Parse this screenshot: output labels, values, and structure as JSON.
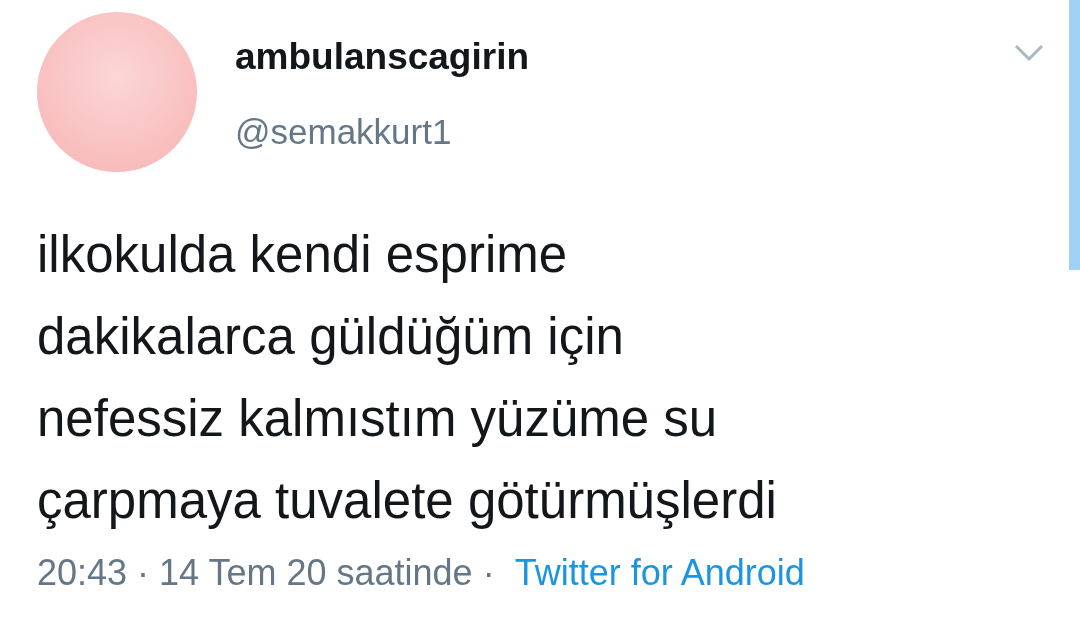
{
  "author": {
    "name": "ambulanscagirin",
    "handle": "@semakkurt1"
  },
  "tweet": {
    "text_lines": [
      "ilkokulda kendi esprime",
      "dakikalarca güldüğüm için",
      "nefessiz kalmıstım yüzüme su",
      "çarpmaya tuvalete götürmüşlerdi"
    ]
  },
  "meta": {
    "timestamp": "20:43 · 14 Tem 20 saatinde ·",
    "source": "Twitter for Android"
  }
}
